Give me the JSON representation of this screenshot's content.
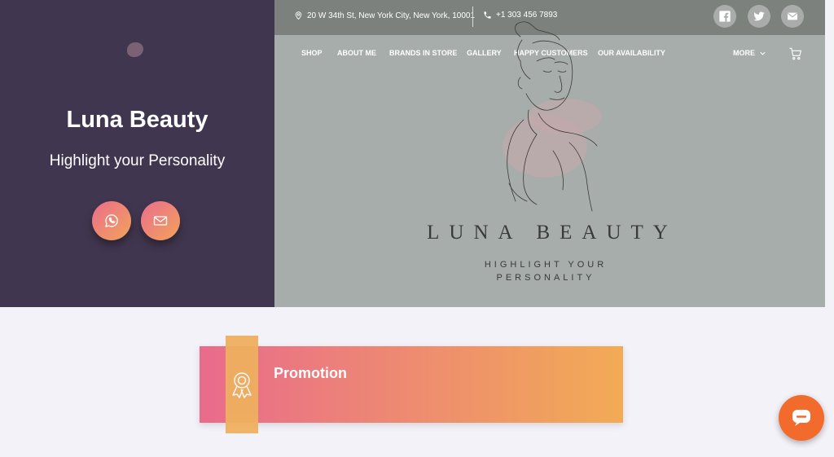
{
  "left_panel": {
    "brand_title": "Luna Beauty",
    "tagline": "Highlight your Personality",
    "buttons": [
      {
        "icon": "whatsapp-icon"
      },
      {
        "icon": "mail-icon"
      }
    ]
  },
  "topbar": {
    "address": "20 W 34th St, New York City, New York, 10001",
    "phone": "+1 303 456 7893",
    "social": [
      "facebook-icon",
      "twitter-icon",
      "mail-icon"
    ]
  },
  "nav": {
    "items": [
      "SHOP",
      "ABOUT ME",
      "BRANDS IN STORE",
      "GALLERY",
      "HAPPY CUSTOMERS",
      "OUR AVAILABILITY"
    ],
    "more": "MORE"
  },
  "hero": {
    "title": "LUNA BEAUTY",
    "subtitle_line1": "HIGHLIGHT YOUR",
    "subtitle_line2": "PERSONALITY"
  },
  "promo": {
    "title": "Promotion",
    "icon": "award-ribbon-icon"
  },
  "colors": {
    "left_panel": "#41364f",
    "hero_bg": "#a6adab",
    "topbar": "#7d817e",
    "gradient_start": "#e96b8c",
    "gradient_end": "#f2ab55",
    "chat_button": "#f26a2c"
  }
}
